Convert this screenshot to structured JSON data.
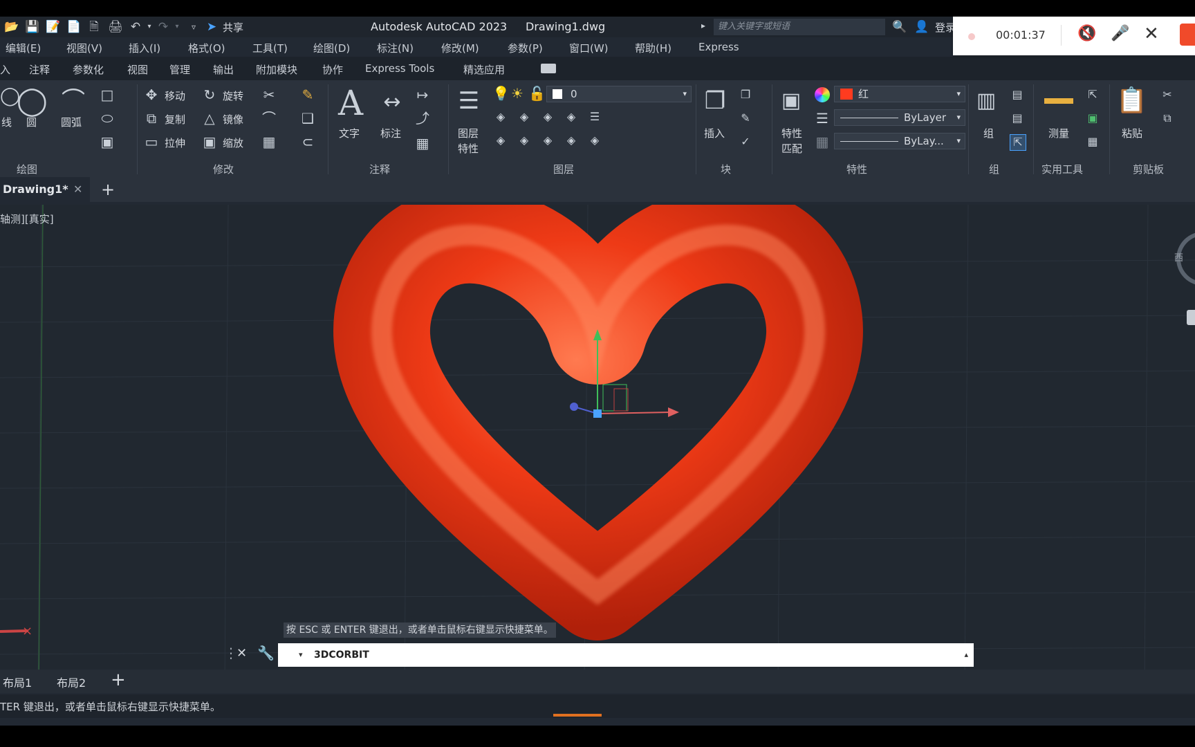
{
  "titlebar": {
    "share_label": "共享",
    "app_title": "Autodesk AutoCAD 2023",
    "file_name": "Drawing1.dwg",
    "search_placeholder": "键入关键字或短语",
    "login_label": "登录"
  },
  "menu": [
    "编辑(E)",
    "视图(V)",
    "插入(I)",
    "格式(O)",
    "工具(T)",
    "绘图(D)",
    "标注(N)",
    "修改(M)",
    "参数(P)",
    "窗口(W)",
    "帮助(H)",
    "Express"
  ],
  "ribbon_tabs": [
    "入",
    "注释",
    "参数化",
    "视图",
    "管理",
    "输出",
    "附加模块",
    "协作",
    "Express Tools",
    "精选应用"
  ],
  "ribbon": {
    "draw": {
      "line": "线",
      "circle": "圆",
      "arc": "圆弧",
      "panel": "绘图"
    },
    "modify": {
      "move": "移动",
      "rotate": "旋转",
      "copy": "复制",
      "mirror": "镜像",
      "stretch": "拉伸",
      "scale": "缩放",
      "panel": "修改"
    },
    "annotation": {
      "text": "文字",
      "dimension": "标注",
      "panel": "注释"
    },
    "layers": {
      "layer_props_line1": "图层",
      "layer_props_line2": "特性",
      "current_layer": "0",
      "panel": "图层"
    },
    "block": {
      "insert": "插入",
      "panel": "块"
    },
    "properties": {
      "match_line1": "特性",
      "match_line2": "匹配",
      "color": "红",
      "linetype": "ByLayer",
      "lineweight": "ByLay...",
      "panel": "特性"
    },
    "groups": {
      "group": "组",
      "panel": "组"
    },
    "utilities": {
      "measure": "测量",
      "panel": "实用工具"
    },
    "clipboard": {
      "paste": "粘贴",
      "panel": "剪贴板"
    }
  },
  "doc_tab": {
    "name": "Drawing1*"
  },
  "viewport": {
    "label": "轴测][真实]",
    "model_color": "#e8381a"
  },
  "viewcube": {
    "letter": "西"
  },
  "command": {
    "hint": "按 ESC 或 ENTER 键退出，或者单击鼠标右键显示快捷菜单。",
    "input": "3DCORBIT"
  },
  "layout_tabs": [
    "布局1",
    "布局2"
  ],
  "status": {
    "message": "TER 键退出，或者单击鼠标右键显示快捷菜单。"
  },
  "recorder": {
    "time": "00:01:37"
  },
  "colors": {
    "accent_red": "#ff3b1f",
    "background": "#212830"
  }
}
